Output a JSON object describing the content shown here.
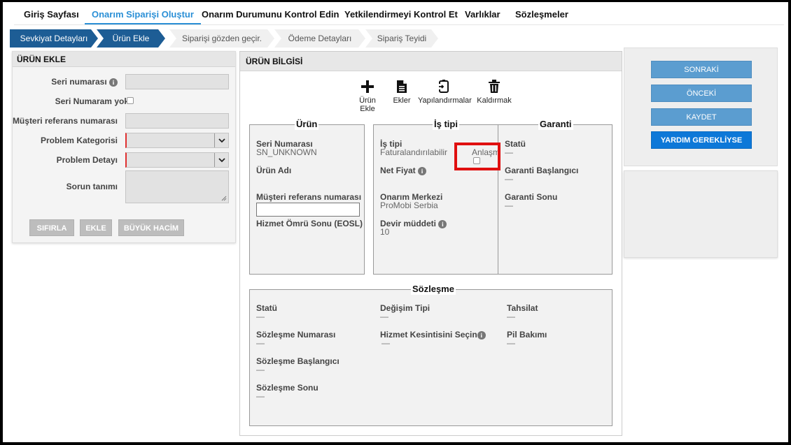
{
  "topnav": {
    "items": [
      "Giriş Sayfası",
      "Onarım Siparişi Oluştur",
      "Onarım Durumunu Kontrol Edin",
      "Yetkilendirmeyi Kontrol Et",
      "Varlıklar",
      "Sözleşmeler"
    ],
    "active_index": 1
  },
  "steps": [
    "Sevkiyat Detayları",
    "Ürün Ekle",
    "Siparişi gözden geçir.",
    "Ödeme Detayları",
    "Sipariş Teyidi"
  ],
  "left": {
    "title": "ÜRÜN EKLE",
    "serial_label": "Seri numarası",
    "no_serial_label": "Seri Numaram yok",
    "customer_ref_label": "Müşteri referans numarası",
    "problem_category_label": "Problem Kategorisi",
    "problem_detail_label": "Problem Detayı",
    "issue_desc_label": "Sorun tanımı",
    "reset_button": "SIFIRLA",
    "add_button": "EKLE",
    "bulk_button": "BÜYÜK HACİM"
  },
  "mid": {
    "title": "ÜRÜN BİLGİSİ",
    "tools": {
      "add_product": "Ürün Ekle",
      "attachments": "Ekler",
      "configurations": "Yapılandırmalar",
      "remove": "Kaldırmak"
    },
    "product": {
      "title": "Ürün",
      "serial_label": "Seri Numarası",
      "serial_value": "SN_UNKNOWN",
      "name_label": "Ürün Adı",
      "customer_ref_label": "Müşteri referans numarası",
      "eosl_label": "Hizmet Ömrü Sonu (EOSL)"
    },
    "job": {
      "title": "İş tipi",
      "job_type_label": "İş tipi",
      "job_type_value": "Faturalandırılabilir",
      "agreement_label": "Anlaşma",
      "net_price_label": "Net Fiyat",
      "repair_center_label": "Onarım Merkezi",
      "repair_center_value": "ProMobi Serbia",
      "turnaround_label": "Devir müddeti",
      "turnaround_value": "10"
    },
    "warranty": {
      "title": "Garanti",
      "status_label": "Statü",
      "status_value": "—",
      "start_label": "Garanti Başlangıcı",
      "start_value": "—",
      "end_label": "Garanti Sonu",
      "end_value": "—"
    },
    "contract": {
      "title": "Sözleşme",
      "status_label": "Statü",
      "status_value": "—",
      "change_type_label": "Değişim Tipi",
      "change_type_value": "—",
      "collection_label": "Tahsilat",
      "collection_value": "—",
      "number_label": "Sözleşme Numarası",
      "number_value": "—",
      "service_cut_label": "Hizmet Kesintisini Seçin",
      "service_cut_value": "—",
      "battery_label": "Pil Bakımı",
      "battery_value": "—",
      "start_label": "Sözleşme Başlangıcı",
      "start_value": "—",
      "end_label": "Sözleşme Sonu",
      "end_value": "—"
    }
  },
  "right": {
    "next_button": "SONRAKİ",
    "prev_button": "ÖNCEKİ",
    "save_button": "KAYDET",
    "help_button": "YARDIM GEREKLİYSE"
  },
  "colors": {
    "accent": "#2a8fd6",
    "step_active": "#1d5d95",
    "button_blue": "#5b9dd0",
    "button_primary": "#0d78d8",
    "required": "#e03030",
    "highlight": "#e01010"
  }
}
